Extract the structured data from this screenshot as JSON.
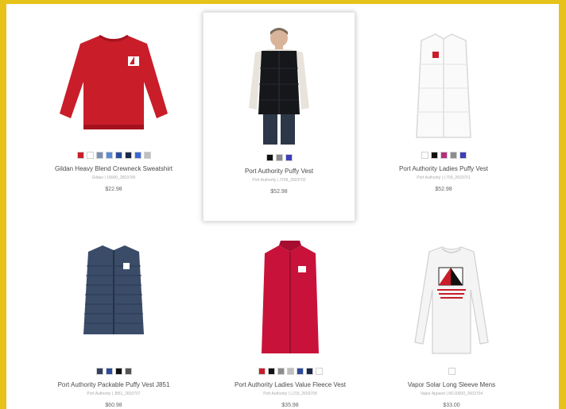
{
  "products": [
    {
      "name": "Gildan Heavy Blend Crewneck Sweatshirt",
      "sku": "Gildan | 18000_2603700",
      "price": "$22.98",
      "image_icon": "red-sweatshirt-icon",
      "swatches": [
        "#c91d2a",
        "#ffffff",
        "#7d8fb3",
        "#5b8ad6",
        "#2c4b9a",
        "#1c2749",
        "#3e67d6",
        "#bfbfbf"
      ]
    },
    {
      "name": "Port Authority Puffy Vest",
      "sku": "Port Authority | J709_2603702",
      "price": "$52.98",
      "image_icon": "man-puffy-vest-icon",
      "swatches": [
        "#111111",
        "#8d8d8d",
        "#3b3fb8"
      ]
    },
    {
      "name": "Port Authority Ladies Puffy Vest",
      "sku": "Port Authority | L709_2603701",
      "price": "$52.98",
      "image_icon": "white-puffy-vest-icon",
      "swatches": [
        "#ffffff",
        "#111111",
        "#b4307f",
        "#8d8d8d",
        "#3b3fb8"
      ]
    },
    {
      "name": "Port Authority Packable Puffy Vest J851",
      "sku": "Port Authority | J851_2603707",
      "price": "$60.98",
      "image_icon": "navy-packable-vest-icon",
      "swatches": [
        "#31415d",
        "#2c4b9a",
        "#111111",
        "#555555"
      ]
    },
    {
      "name": "Port Authority Ladies Value Fleece Vest",
      "sku": "Port Authority | L219_2603708",
      "price": "$35.98",
      "image_icon": "red-fleece-vest-icon",
      "swatches": [
        "#c91d2a",
        "#111111",
        "#8d8d8d",
        "#bfbfbf",
        "#2c4b9a",
        "#1c2749",
        "#ffffff"
      ]
    },
    {
      "name": "Vapor Solar Long Sleeve Mens",
      "sku": "Vapor Apparel | M120000_2603704",
      "price": "$33.00",
      "image_icon": "white-long-sleeve-icon",
      "swatches": [
        "#ffffff"
      ]
    }
  ]
}
